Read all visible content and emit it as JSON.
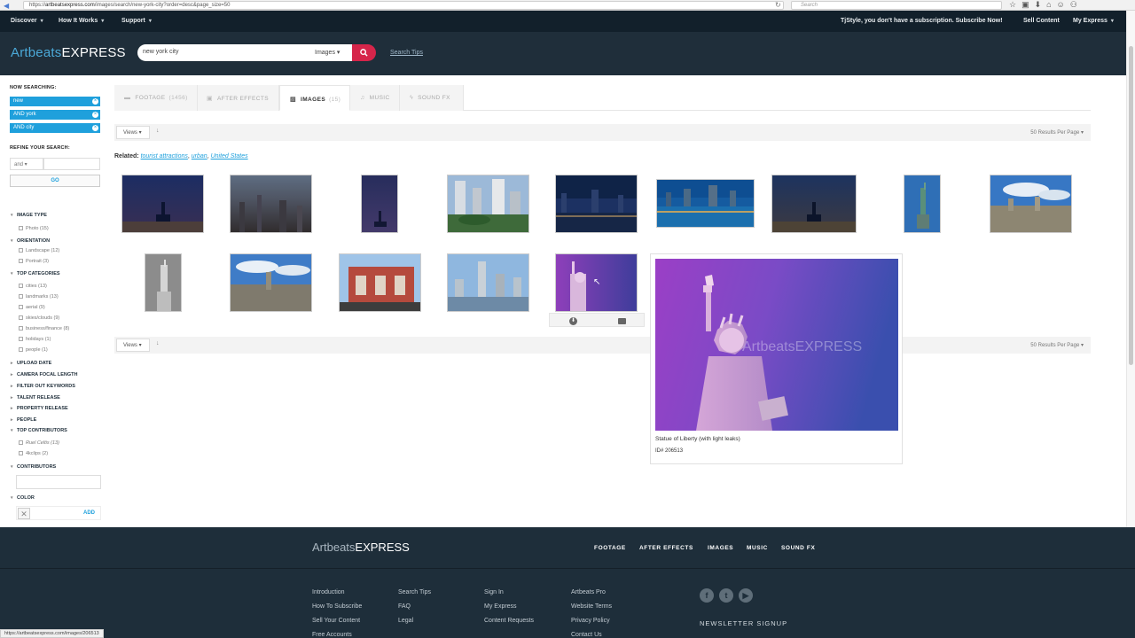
{
  "browser": {
    "url_prefix": "https://",
    "url_domain": "artbeatsexpress.com",
    "url_path": "/images/search/new-york-city?order=desc&page_size=50",
    "search_placeholder": "Search"
  },
  "topnav": {
    "left": [
      "Discover",
      "How It Works",
      "Support"
    ],
    "promo": "TjStyle, you don't have a subscription. Subscribe Now!",
    "sell": "Sell Content",
    "account": "My Express"
  },
  "header": {
    "logo_part1": "Artbeats",
    "logo_part2": "EXPRESS",
    "search_value": "new york city",
    "search_type": "Images",
    "search_tips": "Search Tips"
  },
  "sidebar": {
    "now_searching_label": "NOW SEARCHING:",
    "terms": [
      "new",
      "AND york",
      "AND city"
    ],
    "refine_label": "REFINE YOUR SEARCH:",
    "and_value": "and",
    "go_label": "GO",
    "image_type_label": "IMAGE TYPE",
    "image_type_opts": [
      "Photo (15)"
    ],
    "orientation_label": "ORIENTATION",
    "orientation_opts": [
      "Landscape (12)",
      "Portrait (3)"
    ],
    "top_categories_label": "TOP CATEGORIES",
    "categories": [
      "cities (13)",
      "landmarks (13)",
      "aerial (9)",
      "skies/clouds (9)",
      "business/finance (8)",
      "holidays (1)",
      "people (1)"
    ],
    "upload_date": "UPLOAD DATE",
    "camera_focal": "CAMERA FOCAL LENGTH",
    "filter_keywords": "FILTER OUT KEYWORDS",
    "talent_release": "TALENT RELEASE",
    "property_release": "PROPERTY RELEASE",
    "people": "PEOPLE",
    "top_contributors_label": "TOP CONTRIBUTORS",
    "contributors_opts": [
      "Ruel Celtis (13)",
      "4kclips (2)"
    ],
    "contributors_label": "CONTRIBUTORS",
    "color_label": "COLOR",
    "add_label": "ADD"
  },
  "tabs": [
    {
      "label": "FOOTAGE",
      "count": "(1456)",
      "icon": "film-icon",
      "glyph": "▬"
    },
    {
      "label": "AFTER EFFECTS",
      "count": "",
      "icon": "after-effects-icon",
      "glyph": "▣"
    },
    {
      "label": "IMAGES",
      "count": "(15)",
      "icon": "image-icon",
      "glyph": "▨"
    },
    {
      "label": "MUSIC",
      "count": "",
      "icon": "music-icon",
      "glyph": "♫"
    },
    {
      "label": "SOUND FX",
      "count": "",
      "icon": "sound-icon",
      "glyph": "ϟ"
    }
  ],
  "views": {
    "label": "Views ▾",
    "sort_arrow": "↓",
    "per_page": "50 Results Per Page ▾"
  },
  "related": {
    "label": "Related:",
    "links": [
      "tourist attractions",
      "urban",
      "United States"
    ]
  },
  "preview": {
    "title": "Statue of Liberty (with light leaks)",
    "id": "ID# 206513",
    "watermark": "ArtbeatsEXPRESS"
  },
  "footer": {
    "logo_part1": "Artbeats",
    "logo_part2": "EXPRESS",
    "nav": [
      "FOOTAGE",
      "AFTER EFFECTS",
      "IMAGES",
      "MUSIC",
      "SOUND FX"
    ],
    "col1": [
      "Introduction",
      "How To Subscribe",
      "Sell Your Content",
      "Free Accounts"
    ],
    "col2": [
      "Search Tips",
      "FAQ",
      "Legal"
    ],
    "col3": [
      "Sign In",
      "My Express",
      "Content Requests"
    ],
    "col4": [
      "Artbeats Pro",
      "Website Terms",
      "Privacy Policy",
      "Contact Us"
    ],
    "newsletter": "NEWSLETTER SIGNUP"
  },
  "status_url": "https://artbeatsexpress.com/images/206513"
}
